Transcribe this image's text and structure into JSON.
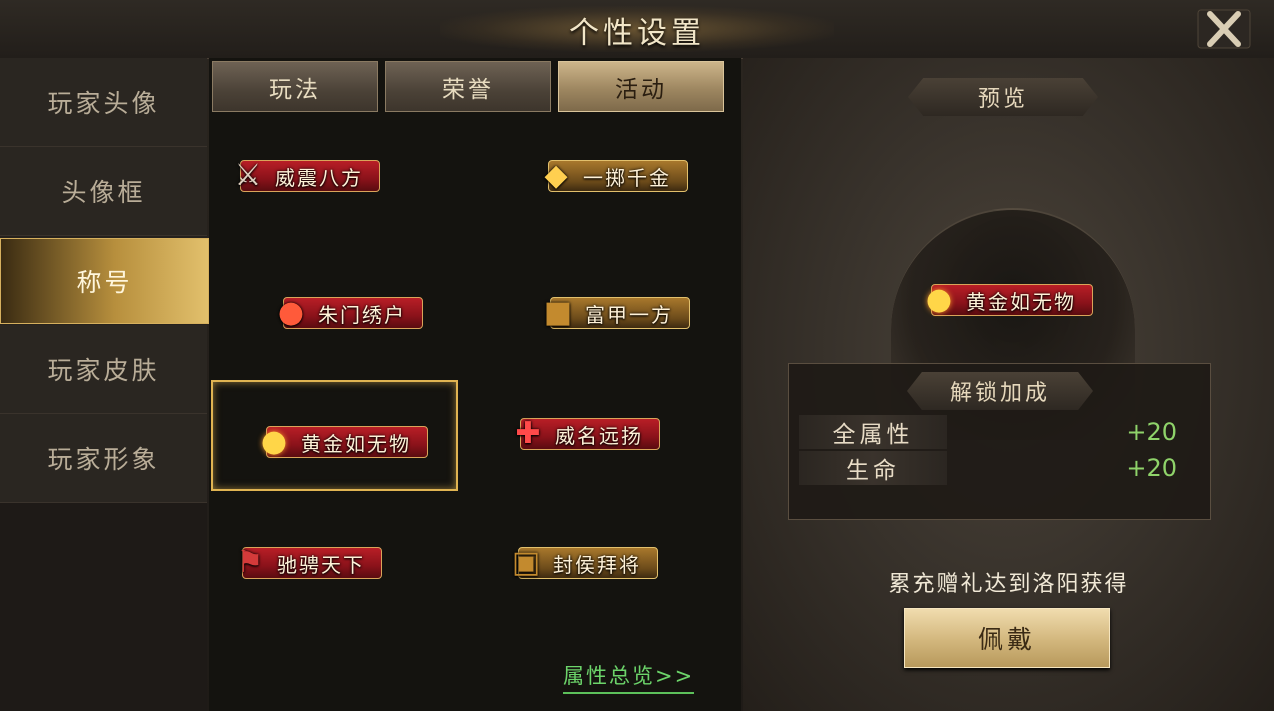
{
  "window": {
    "title": "个性设置",
    "close_icon": "close-icon"
  },
  "sidebar": {
    "items": [
      {
        "label": "玩家头像",
        "active": false
      },
      {
        "label": "头像框",
        "active": false
      },
      {
        "label": "称号",
        "active": true
      },
      {
        "label": "玩家皮肤",
        "active": false
      },
      {
        "label": "玩家形象",
        "active": false
      }
    ]
  },
  "tabs": [
    {
      "label": "玩法",
      "active": false
    },
    {
      "label": "荣誉",
      "active": false
    },
    {
      "label": "活动",
      "active": true
    }
  ],
  "titles": [
    {
      "label": "威震八方",
      "style": "red",
      "icon": "crossed-swords-icon"
    },
    {
      "label": "一掷千金",
      "style": "gold",
      "icon": "gold-ingot-icon"
    },
    {
      "label": "朱门绣户",
      "style": "red",
      "icon": "lantern-icon"
    },
    {
      "label": "富甲一方",
      "style": "gold",
      "icon": "treasure-icon"
    },
    {
      "label": "黄金如无物",
      "style": "red",
      "icon": "gold-coins-icon",
      "selected": true
    },
    {
      "label": "威名远扬",
      "style": "red",
      "icon": "chinese-knot-icon"
    },
    {
      "label": "驰骋天下",
      "style": "red",
      "icon": "war-flag-icon"
    },
    {
      "label": "封侯拜将",
      "style": "gold",
      "icon": "treasure-chest-icon"
    }
  ],
  "overview_link": "属性总览>>",
  "preview": {
    "label": "预览",
    "title": "黄金如无物",
    "stats_header": "解锁加成",
    "stats": [
      {
        "name": "全属性",
        "value": "+20"
      },
      {
        "name": "生命",
        "value": "+20"
      }
    ],
    "obtain_text": "累充赠礼达到洛阳获得",
    "wear_button": "佩戴"
  },
  "colors": {
    "accent_gold": "#e0b452",
    "stat_green": "#8fd36a",
    "link_green": "#6cd46a",
    "banner_red": "#b81e26"
  }
}
